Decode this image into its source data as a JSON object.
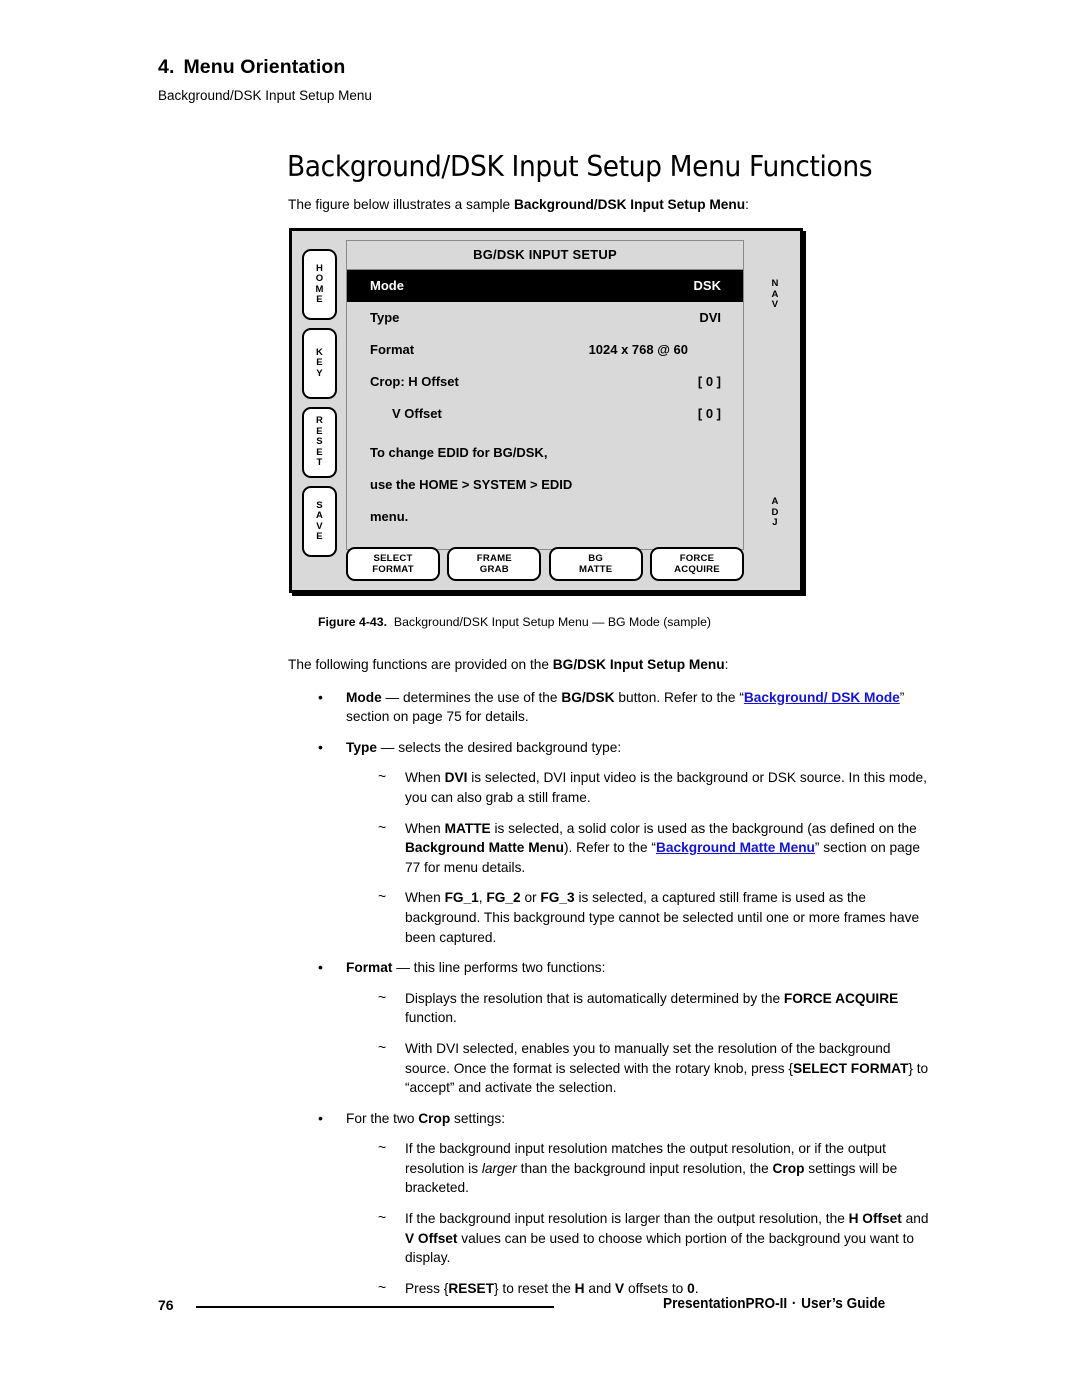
{
  "header": {
    "chapter_number": "4.",
    "chapter_title": "Menu Orientation",
    "subtitle": "Background/DSK Input Setup Menu"
  },
  "title": "Background/DSK Input Setup Menu Functions",
  "intro": {
    "text_before": "The figure below illustrates a sample ",
    "bold": "Background/DSK Input Setup Menu",
    "text_after": ":"
  },
  "panel": {
    "left_buttons": [
      {
        "name": "home",
        "letters": [
          "H",
          "O",
          "M",
          "E"
        ]
      },
      {
        "name": "key",
        "letters": [
          "K",
          "E",
          "Y"
        ]
      },
      {
        "name": "reset",
        "letters": [
          "R",
          "E",
          "S",
          "E",
          "T"
        ]
      },
      {
        "name": "save",
        "letters": [
          "S",
          "A",
          "V",
          "E"
        ]
      }
    ],
    "right_labels": {
      "nav": [
        "N",
        "A",
        "V"
      ],
      "adj": [
        "A",
        "D",
        "J"
      ]
    },
    "lcd": {
      "title": "BG/DSK INPUT SETUP",
      "rows": [
        {
          "label": "Mode",
          "value": "DSK",
          "selected": true,
          "indent": false,
          "value_mid": false
        },
        {
          "label": "Type",
          "value": "DVI",
          "selected": false,
          "indent": false,
          "value_mid": false
        },
        {
          "label": "Format",
          "value": "1024 x 768 @ 60",
          "selected": false,
          "indent": false,
          "value_mid": true
        },
        {
          "label": "Crop:  H Offset",
          "value": "[ 0 ]",
          "selected": false,
          "indent": false,
          "value_mid": false
        },
        {
          "label": "V Offset",
          "value": "[ 0 ]",
          "selected": false,
          "indent": true,
          "value_mid": false
        }
      ],
      "notes": [
        "To change EDID for BG/DSK,",
        "use the HOME > SYSTEM > EDID",
        "menu."
      ]
    },
    "soft_buttons": [
      {
        "name": "select-format",
        "line1": "SELECT",
        "line2": "FORMAT"
      },
      {
        "name": "frame-grab",
        "line1": "FRAME",
        "line2": "GRAB"
      },
      {
        "name": "bg-matte",
        "line1": "BG",
        "line2": "MATTE"
      },
      {
        "name": "force-acquire",
        "line1": "FORCE",
        "line2": "ACQUIRE"
      }
    ]
  },
  "figure_caption": {
    "label": "Figure 4-43.",
    "text": "Background/DSK Input Setup Menu — BG Mode  (sample)"
  },
  "body": {
    "lead_in": {
      "before": "The following functions are provided on the ",
      "bold": "BG/DSK Input Setup Menu",
      "after": ":"
    },
    "items": [
      {
        "marker": "•",
        "level": "bullet",
        "parts": [
          {
            "t": "Mode",
            "s": "b"
          },
          {
            "t": " — determines the use of the ",
            "s": "n"
          },
          {
            "t": "BG/DSK",
            "s": "b"
          },
          {
            "t": " button.  Refer to the “",
            "s": "n"
          },
          {
            "t": "Background/ DSK Mode",
            "s": "link"
          },
          {
            "t": "” section on page 75 for details.",
            "s": "n"
          }
        ]
      },
      {
        "marker": "•",
        "level": "bullet",
        "parts": [
          {
            "t": "Type",
            "s": "b"
          },
          {
            "t": " — selects the desired background type:",
            "s": "n"
          }
        ]
      },
      {
        "marker": "~",
        "level": "sub",
        "parts": [
          {
            "t": "When ",
            "s": "n"
          },
          {
            "t": "DVI",
            "s": "b"
          },
          {
            "t": " is selected, DVI input video is the background or DSK source.  In this mode, you can also grab a still frame.",
            "s": "n"
          }
        ]
      },
      {
        "marker": "~",
        "level": "sub",
        "parts": [
          {
            "t": "When ",
            "s": "n"
          },
          {
            "t": "MATTE",
            "s": "b"
          },
          {
            "t": " is selected, a solid color is used as the background (as defined on the ",
            "s": "n"
          },
          {
            "t": "Background Matte Menu",
            "s": "b"
          },
          {
            "t": ").  Refer to the “",
            "s": "n"
          },
          {
            "t": "Background Matte Menu",
            "s": "link"
          },
          {
            "t": "” section on page 77 for menu details.",
            "s": "n"
          }
        ]
      },
      {
        "marker": "~",
        "level": "sub",
        "parts": [
          {
            "t": "When ",
            "s": "n"
          },
          {
            "t": "FG_1",
            "s": "b"
          },
          {
            "t": ", ",
            "s": "n"
          },
          {
            "t": "FG_2",
            "s": "b"
          },
          {
            "t": " or ",
            "s": "n"
          },
          {
            "t": "FG_3",
            "s": "b"
          },
          {
            "t": " is selected, a captured still frame is used as the background.  This background type cannot be selected until one or more frames have been captured.",
            "s": "n"
          }
        ]
      },
      {
        "marker": "•",
        "level": "bullet",
        "parts": [
          {
            "t": "Format",
            "s": "b"
          },
          {
            "t": " — this line performs two functions:",
            "s": "n"
          }
        ]
      },
      {
        "marker": "~",
        "level": "sub",
        "parts": [
          {
            "t": "Displays the resolution that is automatically determined by the ",
            "s": "n"
          },
          {
            "t": "FORCE ACQUIRE",
            "s": "b"
          },
          {
            "t": " function.",
            "s": "n"
          }
        ]
      },
      {
        "marker": "~",
        "level": "sub",
        "parts": [
          {
            "t": "With DVI selected, enables you to manually set the resolution of the background source.  Once the format is selected with the rotary knob, press {",
            "s": "n"
          },
          {
            "t": "SELECT FORMAT",
            "s": "b"
          },
          {
            "t": "} to “accept” and activate the selection.",
            "s": "n"
          }
        ]
      },
      {
        "marker": "•",
        "level": "bullet",
        "parts": [
          {
            "t": "For the two ",
            "s": "n"
          },
          {
            "t": "Crop",
            "s": "b"
          },
          {
            "t": " settings:",
            "s": "n"
          }
        ]
      },
      {
        "marker": "~",
        "level": "sub",
        "parts": [
          {
            "t": "If the background input resolution matches the output resolution, or if the output resolution is ",
            "s": "n"
          },
          {
            "t": "larger",
            "s": "i"
          },
          {
            "t": " than the background input resolution, the ",
            "s": "n"
          },
          {
            "t": "Crop",
            "s": "b"
          },
          {
            "t": " settings will be bracketed.",
            "s": "n"
          }
        ]
      },
      {
        "marker": "~",
        "level": "sub",
        "parts": [
          {
            "t": "If the background input resolution is larger than the output resolution, the ",
            "s": "n"
          },
          {
            "t": "H Offset",
            "s": "b"
          },
          {
            "t": " and ",
            "s": "n"
          },
          {
            "t": "V Offset",
            "s": "b"
          },
          {
            "t": " values can be used to choose which portion of the background you want to display.",
            "s": "n"
          }
        ]
      },
      {
        "marker": "~",
        "level": "sub",
        "parts": [
          {
            "t": "Press {",
            "s": "n"
          },
          {
            "t": "RESET",
            "s": "b"
          },
          {
            "t": "} to reset the ",
            "s": "n"
          },
          {
            "t": "H",
            "s": "b"
          },
          {
            "t": " and ",
            "s": "n"
          },
          {
            "t": "V",
            "s": "b"
          },
          {
            "t": " offsets to ",
            "s": "n"
          },
          {
            "t": "0",
            "s": "b"
          },
          {
            "t": ".",
            "s": "n"
          }
        ]
      }
    ]
  },
  "footer": {
    "page_number": "76",
    "product": "PresentationPRO-II",
    "separator": "·",
    "doc_type": "User’s Guide"
  },
  "colors": {
    "link": "#1414d2",
    "panel_bg": "#d9d9d9",
    "selection_bg": "#000000"
  }
}
